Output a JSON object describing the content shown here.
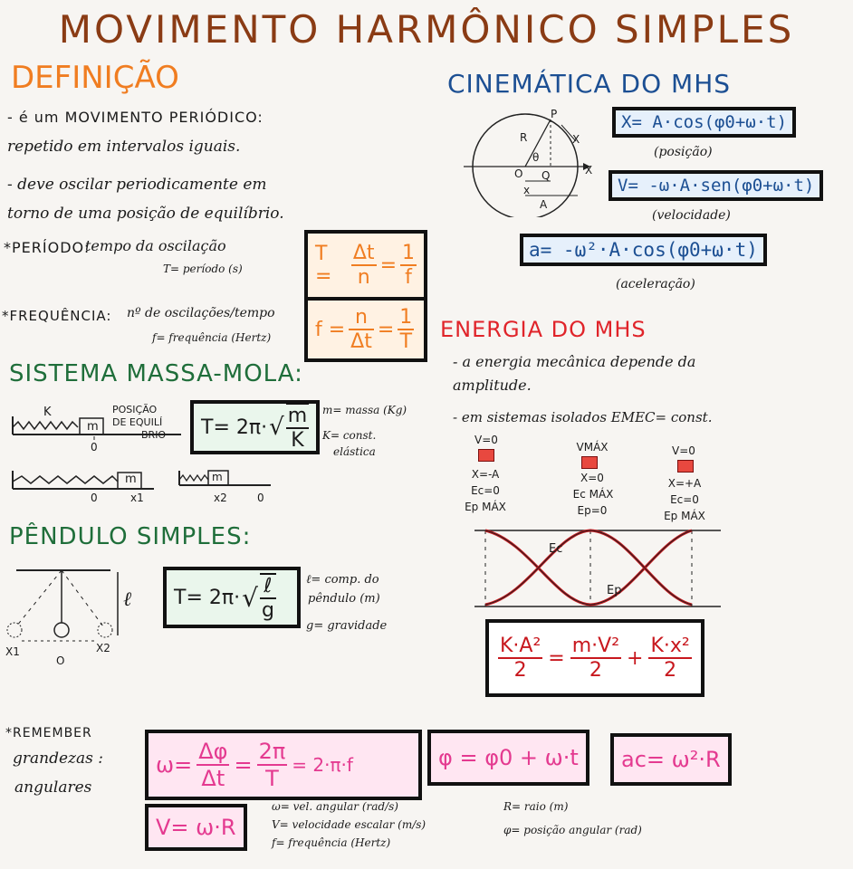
{
  "title": "MOVIMENTO HARMÔNICO SIMPLES",
  "definicao": {
    "heading": "DEFINIÇÃO",
    "line1": "- é um MOVIMENTO PERIÓDICO:",
    "line2": "repetido em intervalos iguais.",
    "line3": "- deve oscilar periodicamente em",
    "line4": "torno de uma posição de equilíbrio.",
    "periodo_label": "*PERÍODO:",
    "periodo_desc": "tempo da oscilação",
    "periodo_sub": "T= período (s)",
    "periodo_T": "T =",
    "periodo_num": "Δt",
    "periodo_den": "n",
    "periodo_eq": "=",
    "periodo_num2": "1",
    "periodo_den2": "f",
    "freq_label": "*FREQUÊNCIA:",
    "freq_desc": "nº de oscilações/tempo",
    "freq_sub": "f= frequência (Hertz)",
    "freq_f": "f =",
    "freq_num": "n",
    "freq_den": "Δt",
    "freq_eq": "=",
    "freq_num2": "1",
    "freq_den2": "T"
  },
  "massa_mola": {
    "heading": "SISTEMA MASSA-MOLA:",
    "K": "K",
    "m": "m",
    "pos_eq1": "POSIÇÃO",
    "pos_eq2": "DE EQUILÍ",
    "pos_eq3": "BRIO",
    "zero": "0",
    "x1": "x1",
    "x2": "x2",
    "formula_pre": "T= 2π·",
    "formula_num": "m",
    "formula_den": "K",
    "m_desc": "m= massa (Kg)",
    "k_desc1": "K= const.",
    "k_desc2": "elástica"
  },
  "pendulo": {
    "heading": "PÊNDULO SIMPLES:",
    "l": "ℓ",
    "X1": "X1",
    "O": "O",
    "X2": "X2",
    "formula_pre": "T= 2π·",
    "formula_num": "ℓ",
    "formula_den": "g",
    "l_desc1": "ℓ= comp. do",
    "l_desc2": "pêndulo (m)",
    "g_desc": "g= gravidade"
  },
  "cinematica": {
    "heading": "CINEMÁTICA DO MHS",
    "P": "P",
    "R": "R",
    "theta": "θ",
    "O": "O",
    "Q": "Q",
    "x": "x",
    "A": "A",
    "X": "X",
    "posicao_formula": "X= A·cos(φ0+ω·t)",
    "posicao_label": "(posição)",
    "velocidade_formula": "V= -ω·A·sen(φ0+ω·t)",
    "velocidade_label": "(velocidade)",
    "aceleracao_formula": "a= -ω²·A·cos(φ0+ω·t)",
    "aceleracao_label": "(aceleração)"
  },
  "energia": {
    "heading": "ENERGIA DO MHS",
    "line1": "- a energia mecânica depende da",
    "line2": "amplitude.",
    "line3": "- em sistemas isolados EMEC= const.",
    "states": [
      {
        "top": "V=0",
        "l1": "X=-A",
        "l2": "Ec=0",
        "l3": "Ep MÁX"
      },
      {
        "top": "VMÁX",
        "l1": "X=0",
        "l2": "Ec MÁX",
        "l3": "Ep=0"
      },
      {
        "top": "V=0",
        "l1": "X=+A",
        "l2": "Ec=0",
        "l3": "Ep MÁX"
      }
    ],
    "Ec": "Ec",
    "Ep": "Ep",
    "formula": {
      "t1n": "K·A²",
      "t1d": "2",
      "eq": "=",
      "t2n": "m·V²",
      "t2d": "2",
      "plus": "+",
      "t3n": "K·x²",
      "t3d": "2"
    }
  },
  "grandezas": {
    "remember": "*REMEMBER",
    "label1": "grandezas :",
    "label2": "angulares",
    "omega_pre": "ω=",
    "omega_n1": "Δφ",
    "omega_d1": "Δt",
    "omega_eq": "=",
    "omega_n2": "2π",
    "omega_d2": "T",
    "omega_tail": "= 2·π·f",
    "phi_formula": "φ = φ0 + ω·t",
    "ac_formula": "ac= ω²·R",
    "v_formula": "V= ω·R",
    "legend": [
      "ω= vel. angular (rad/s)",
      "V= velocidade escalar (m/s)",
      "f= frequência (Hertz)",
      "R= raio (m)",
      "φ= posição angular (rad)"
    ]
  },
  "colors": {
    "title": "#8a3b14",
    "orange": "#f07d21",
    "blue": "#1c4f93",
    "green": "#1f6e3a",
    "red": "#e0242a",
    "pink": "#e43a90"
  }
}
